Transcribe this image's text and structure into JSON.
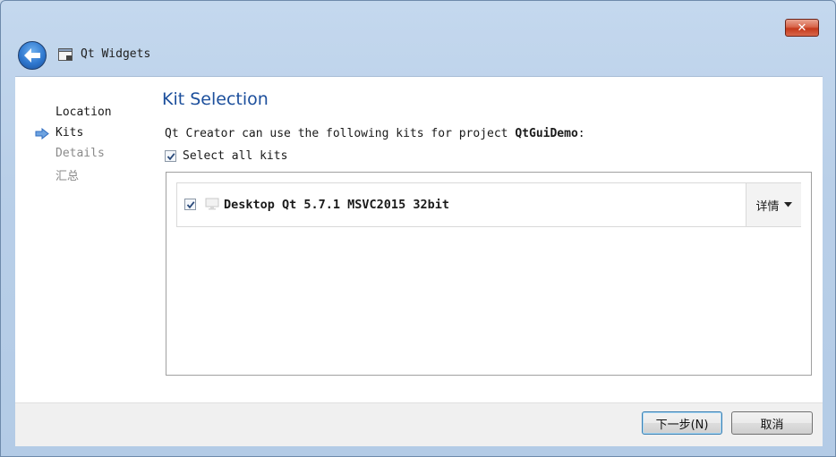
{
  "window": {
    "title": "Qt Widgets",
    "close_label": "✕"
  },
  "nav": {
    "items": [
      {
        "label": "Location",
        "state": "done"
      },
      {
        "label": "Kits",
        "state": "current"
      },
      {
        "label": "Details",
        "state": "pending"
      },
      {
        "label": "汇总",
        "state": "pending"
      }
    ]
  },
  "page": {
    "title": "Kit Selection",
    "description_prefix": "Qt Creator can use the following kits for project ",
    "project_name": "QtGuiDemo",
    "description_suffix": ":",
    "select_all_label": "Select all kits",
    "select_all_checked": true
  },
  "kits": [
    {
      "name": "Desktop Qt 5.7.1 MSVC2015 32bit",
      "checked": true,
      "details_label": "详情"
    }
  ],
  "footer": {
    "next_label": "下一步(N)",
    "cancel_label": "取消"
  },
  "colors": {
    "accent_title": "#1c4f9c",
    "close_red": "#c5391b",
    "arrow_blue": "#3b82d6"
  }
}
